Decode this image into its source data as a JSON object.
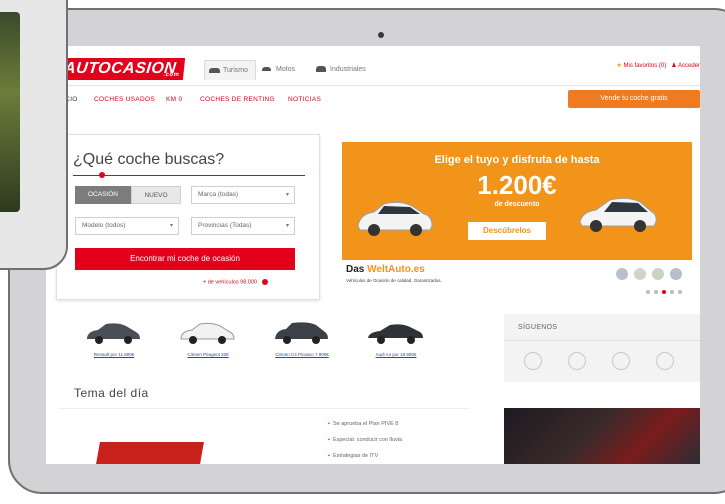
{
  "header": {
    "logo": "AUTOCASION",
    "logo_sub": ".com",
    "vehicle_tabs": [
      {
        "label": "Turismo"
      },
      {
        "label": "Motos"
      },
      {
        "label": "Industriales"
      }
    ],
    "favorites": "Mis favoritos (0)",
    "account": "Acceder"
  },
  "nav": {
    "items": [
      {
        "label": "INICIO"
      },
      {
        "label": "COCHES USADOS"
      },
      {
        "label": "KM 0"
      },
      {
        "label": "COCHES DE RENTING"
      },
      {
        "label": "NOTICIAS"
      }
    ],
    "publish_button": "Vende tu coche gratis"
  },
  "search": {
    "title": "¿Qué coche buscas?",
    "tab_used": "OCASIÓN",
    "tab_new": "NUEVO",
    "brand_select": "Marca (todas)",
    "model_select": "Modelo (todos)",
    "province_select": "Provincias (Todas)",
    "find_button": "Encontrar mi coche de ocasión",
    "vehicles_link": "+ de vehículos 98.000"
  },
  "banner": {
    "headline": "Elige el tuyo y disfruta de hasta",
    "amount": "1.200€",
    "sub": "de descuento",
    "button": "Descúbrelos",
    "brand_prefix": "Das ",
    "brand_name": "WeltAuto.es",
    "brand_tag": "Vehículos de Ocasión de calidad. Garantizados."
  },
  "offers": [
    {
      "label": "Renault por 11.800€"
    },
    {
      "label": "Citroen Peugeot 208"
    },
    {
      "label": "Citroen C4 Picasso 7.900€"
    },
    {
      "label": "Audi A4 por 18.900€"
    }
  ],
  "social": {
    "title": "SÍGUENOS",
    "icons": [
      "twitter-icon",
      "google-plus-icon",
      "facebook-icon",
      "youtube-icon"
    ]
  },
  "topic": {
    "title": "Tema del día",
    "items": [
      {
        "label": "Se aprueba el Plan PIVE 8"
      },
      {
        "label": "Especial: conducir con lluvia"
      },
      {
        "label": "Estrategias de ITV"
      }
    ]
  },
  "colors": {
    "brand_red": "#e2001a",
    "banner_orange": "#f29419",
    "publish_orange": "#f07a1e"
  }
}
